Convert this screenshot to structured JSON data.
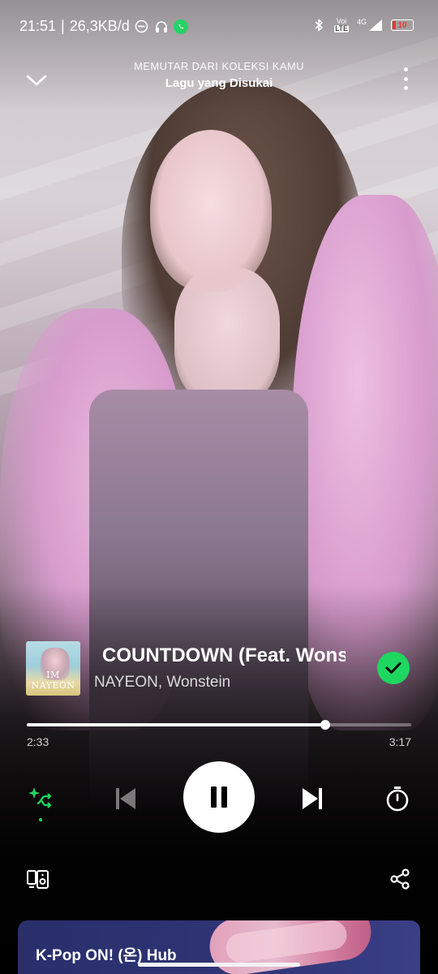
{
  "status_bar": {
    "time": "21:51",
    "separator": "|",
    "net_speed": "26,3KB/d",
    "network_top": "Voi",
    "network_bottom": "LTE",
    "signal_type": "4G",
    "battery": "10",
    "icons": [
      "dnd-icon",
      "headphones-icon",
      "whatsapp-icon",
      "bluetooth-icon",
      "volte-icon",
      "signal-icon",
      "battery-icon"
    ]
  },
  "header": {
    "context": "MEMUTAR DARI KOLEKSI KAMU",
    "playlist": "Lagu yang Disukai"
  },
  "track": {
    "title": "COUNTDOWN (Feat. Wonstein)",
    "artist": "NAYEON, Wonstein",
    "cover_text": "IM NAYEON",
    "liked": true
  },
  "progress": {
    "elapsed": "2:33",
    "total": "3:17",
    "fraction": 0.777
  },
  "controls": {
    "shuffle": "smart-shuffle-icon",
    "previous": "skip-previous-icon",
    "play_state": "pause-icon",
    "next": "skip-next-icon",
    "timer": "sleep-timer-icon"
  },
  "bottom": {
    "devices": "connect-devices-icon",
    "share": "share-icon"
  },
  "card": {
    "title": "K-Pop ON! (온) Hub"
  },
  "colors": {
    "accent": "#1ed760",
    "battery_low": "#e53935",
    "card_bg": "#2e3475"
  }
}
